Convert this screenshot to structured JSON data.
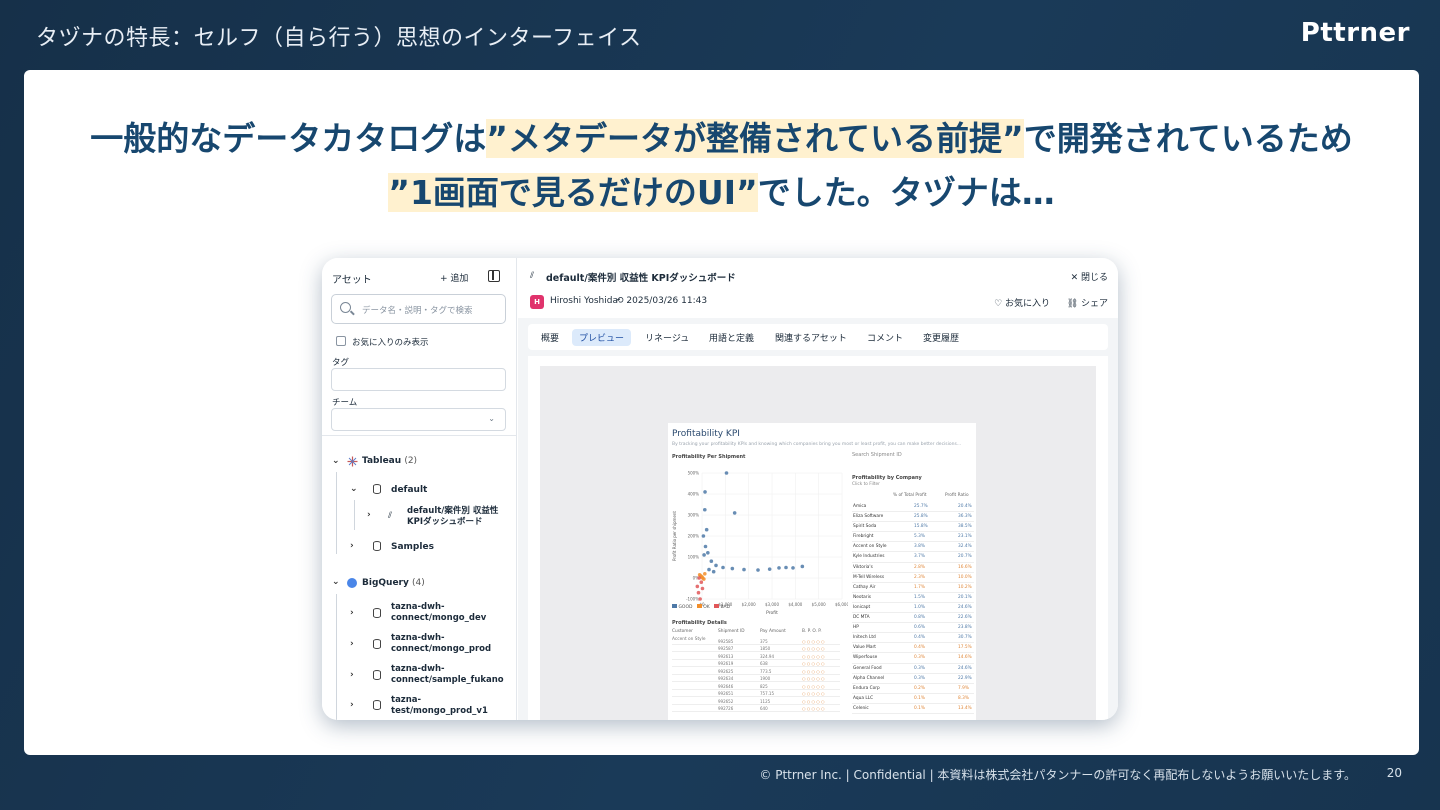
{
  "slide": {
    "title": "タヅナの特長：セルフ（自ら行う）思想のインターフェイス",
    "brand": "Pttrner",
    "headline_line1_a": "一般的なデータカタログは",
    "headline_line1_b": "”メタデータが整備されている前提”",
    "headline_line1_c": "で開発されているため",
    "headline_line2_a": "”1画面で見るだけのUI”",
    "headline_line2_b": "でした。タヅナは…",
    "footer": "© Pttrner Inc. | Confidential | 本資料は株式会社パタンナーの許可なく再配布しないようお願いいたします。",
    "page_number": "20",
    "colors": {
      "background": "#163049",
      "headline": "#17476f",
      "highlight": "#fff1cf"
    }
  },
  "sidebar": {
    "title": "アセット",
    "add_label": "+ 追加",
    "search_placeholder": "データ名・説明・タグで検索",
    "favorites_only": "お気に入りのみ表示",
    "tag_label": "タグ",
    "team_label": "チーム",
    "tree": {
      "tableau_label": "Tableau",
      "tableau_count": "(2)",
      "default_label": "default",
      "dashboard_line1": "default/案件別 収益性",
      "dashboard_line2": "KPIダッシュボード",
      "samples_label": "Samples",
      "bigquery_label": "BigQuery",
      "bigquery_count": "(4)",
      "ds1_line1": "tazna-dwh-",
      "ds1_line2": "connect/mongo_dev",
      "ds2_line1": "tazna-dwh-",
      "ds2_line2": "connect/mongo_prod",
      "ds3_line1": "tazna-dwh-",
      "ds3_line2": "connect/sample_fukano",
      "ds4_line1": "tazna-",
      "ds4_line2": "test/mongo_prod_v1"
    }
  },
  "main": {
    "title": "default/案件別 収益性 KPIダッシュボード",
    "close_label": "✕ 閉じる",
    "avatar_letter": "H",
    "author": "Hiroshi Yoshida",
    "date": "2025/03/26 11:43",
    "favorite_label": "♡ お気に入り",
    "share_label": "シェア",
    "tabs": [
      "概要",
      "プレビュー",
      "リネージュ",
      "用語と定義",
      "関連するアセット",
      "コメント",
      "変更履歴"
    ],
    "active_tab": "プレビュー"
  },
  "preview": {
    "kpi_title": "Profitability KPI",
    "kpi_subtitle": "By tracking your profitability KPIs and knowing which companies bring you most or least profit, you can make better decisions...",
    "scatter_title": "Profitability Per Shipment",
    "search_label": "Search Shipment ID",
    "company_title": "Profitability by Company",
    "company_sub": "Click to Filter",
    "col1": "% of Total Profit",
    "col2": "Profit Ratio",
    "details_title": "Profitability Details",
    "details_customer": "Customer",
    "details_customer_value": "Accent on Style",
    "details_shipment": "Shipment ID",
    "details_pay": "Pay Amount",
    "details_flags": "B.  P.  O.     P.",
    "legend_good": "GOOD",
    "legend_ok": "OK",
    "legend_bad": "BAD",
    "x_label": "Profit",
    "y_label": "Profit Ratio per shipment",
    "x_ticks": [
      "$0",
      "$1,000",
      "$2,000",
      "$3,000",
      "$4,000",
      "$5,000",
      "$6,000"
    ],
    "y_ticks": [
      "500%",
      "400%",
      "300%",
      "200%",
      "100%",
      "0%",
      "-100%"
    ],
    "companies": [
      [
        "Amica",
        "25.7%",
        "20.4%"
      ],
      [
        "Eliza Software",
        "25.8%",
        "36.3%"
      ],
      [
        "Spirit Soda",
        "15.8%",
        "38.5%"
      ],
      [
        "Firebright",
        "5.3%",
        "23.1%"
      ],
      [
        "Accent on Style",
        "3.8%",
        "32.4%"
      ],
      [
        "Kyle Industries",
        "3.7%",
        "20.7%"
      ],
      [
        "Viktoria's",
        "2.8%",
        "16.6%"
      ],
      [
        "M-Tell Wireless",
        "2.3%",
        "10.0%"
      ],
      [
        "Cathay Air",
        "1.7%",
        "10.2%"
      ],
      [
        "Neotaris",
        "1.5%",
        "20.1%"
      ],
      [
        "Ionicapt",
        "1.0%",
        "24.6%"
      ],
      [
        "DC MTA",
        "0.8%",
        "22.6%"
      ],
      [
        "HP",
        "0.6%",
        "23.8%"
      ],
      [
        "Initech Ltd",
        "0.4%",
        "30.7%"
      ],
      [
        "Value Mart",
        "0.4%",
        "17.5%"
      ],
      [
        "Wiperfouse",
        "0.3%",
        "14.6%"
      ],
      [
        "General Food",
        "0.3%",
        "24.6%"
      ],
      [
        "Alpha Channel",
        "0.3%",
        "22.9%"
      ],
      [
        "Endura Corp",
        "0.2%",
        "7.9%"
      ],
      [
        "Aqua LLC",
        "0.1%",
        "8.3%"
      ],
      [
        "Celenic",
        "0.1%",
        "13.4%"
      ]
    ],
    "details_rows": [
      [
        "992585",
        "375"
      ],
      [
        "992587",
        "1850"
      ],
      [
        "992613",
        "324.94"
      ],
      [
        "992619",
        "638"
      ],
      [
        "992625",
        "773.5"
      ],
      [
        "992634",
        "1900"
      ],
      [
        "992646",
        "825"
      ],
      [
        "992651",
        "757.15"
      ],
      [
        "992652",
        "1125"
      ],
      [
        "992726",
        "640"
      ]
    ]
  },
  "chart_data": {
    "type": "scatter",
    "title": "Profitability Per Shipment",
    "xlabel": "Profit",
    "ylabel": "Profit Ratio per shipment",
    "xlim": [
      0,
      6000
    ],
    "ylim": [
      -100,
      500
    ],
    "x_tick_labels": [
      "$0",
      "$1,000",
      "$2,000",
      "$3,000",
      "$4,000",
      "$5,000",
      "$6,000"
    ],
    "y_tick_labels": [
      "500%",
      "400%",
      "300%",
      "200%",
      "100%",
      "0%",
      "-100%"
    ],
    "series": [
      {
        "name": "GOOD",
        "color": "#4e79a7",
        "points": [
          [
            1050,
            500
          ],
          [
            1400,
            310
          ],
          [
            130,
            410
          ],
          [
            120,
            325
          ],
          [
            60,
            200
          ],
          [
            150,
            150
          ],
          [
            250,
            120
          ],
          [
            400,
            80
          ],
          [
            600,
            60
          ],
          [
            900,
            50
          ],
          [
            1300,
            45
          ],
          [
            1800,
            40
          ],
          [
            2400,
            38
          ],
          [
            2900,
            42
          ],
          [
            3300,
            48
          ],
          [
            3600,
            50
          ],
          [
            3900,
            48
          ],
          [
            4300,
            55
          ],
          [
            200,
            230
          ],
          [
            90,
            110
          ],
          [
            300,
            40
          ],
          [
            500,
            30
          ]
        ]
      },
      {
        "name": "OK",
        "color": "#f28e2b",
        "points": [
          [
            0,
            5
          ],
          [
            -50,
            10
          ],
          [
            30,
            0
          ],
          [
            80,
            -5
          ],
          [
            120,
            20
          ],
          [
            -100,
            15
          ]
        ]
      },
      {
        "name": "BAD",
        "color": "#e15759",
        "points": [
          [
            -150,
            -70
          ],
          [
            -80,
            -100
          ],
          [
            -200,
            -40
          ],
          [
            -30,
            -20
          ],
          [
            -120,
            0
          ],
          [
            20,
            -50
          ]
        ]
      }
    ],
    "legend": "bottom"
  }
}
